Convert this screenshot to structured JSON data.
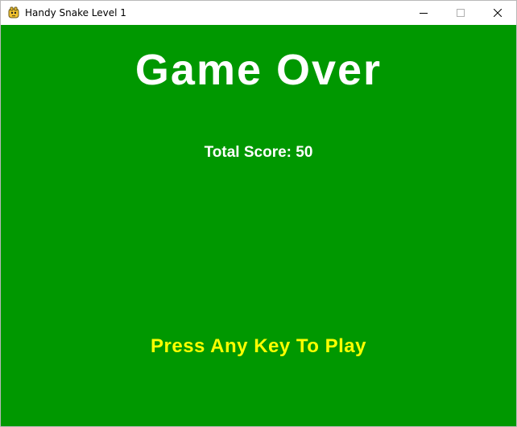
{
  "window": {
    "title": "Handy Snake Level 1",
    "app_icon": "python-snake-icon",
    "buttons": [
      "minimize-icon",
      "maximize-icon",
      "close-icon"
    ]
  },
  "game": {
    "background_color": "#009800",
    "heading": "Game Over",
    "score_label": "Total Score:",
    "score_value": "50",
    "prompt": "Press Any Key To Play",
    "prompt_color": "#ffff00",
    "text_color": "#ffffff"
  }
}
